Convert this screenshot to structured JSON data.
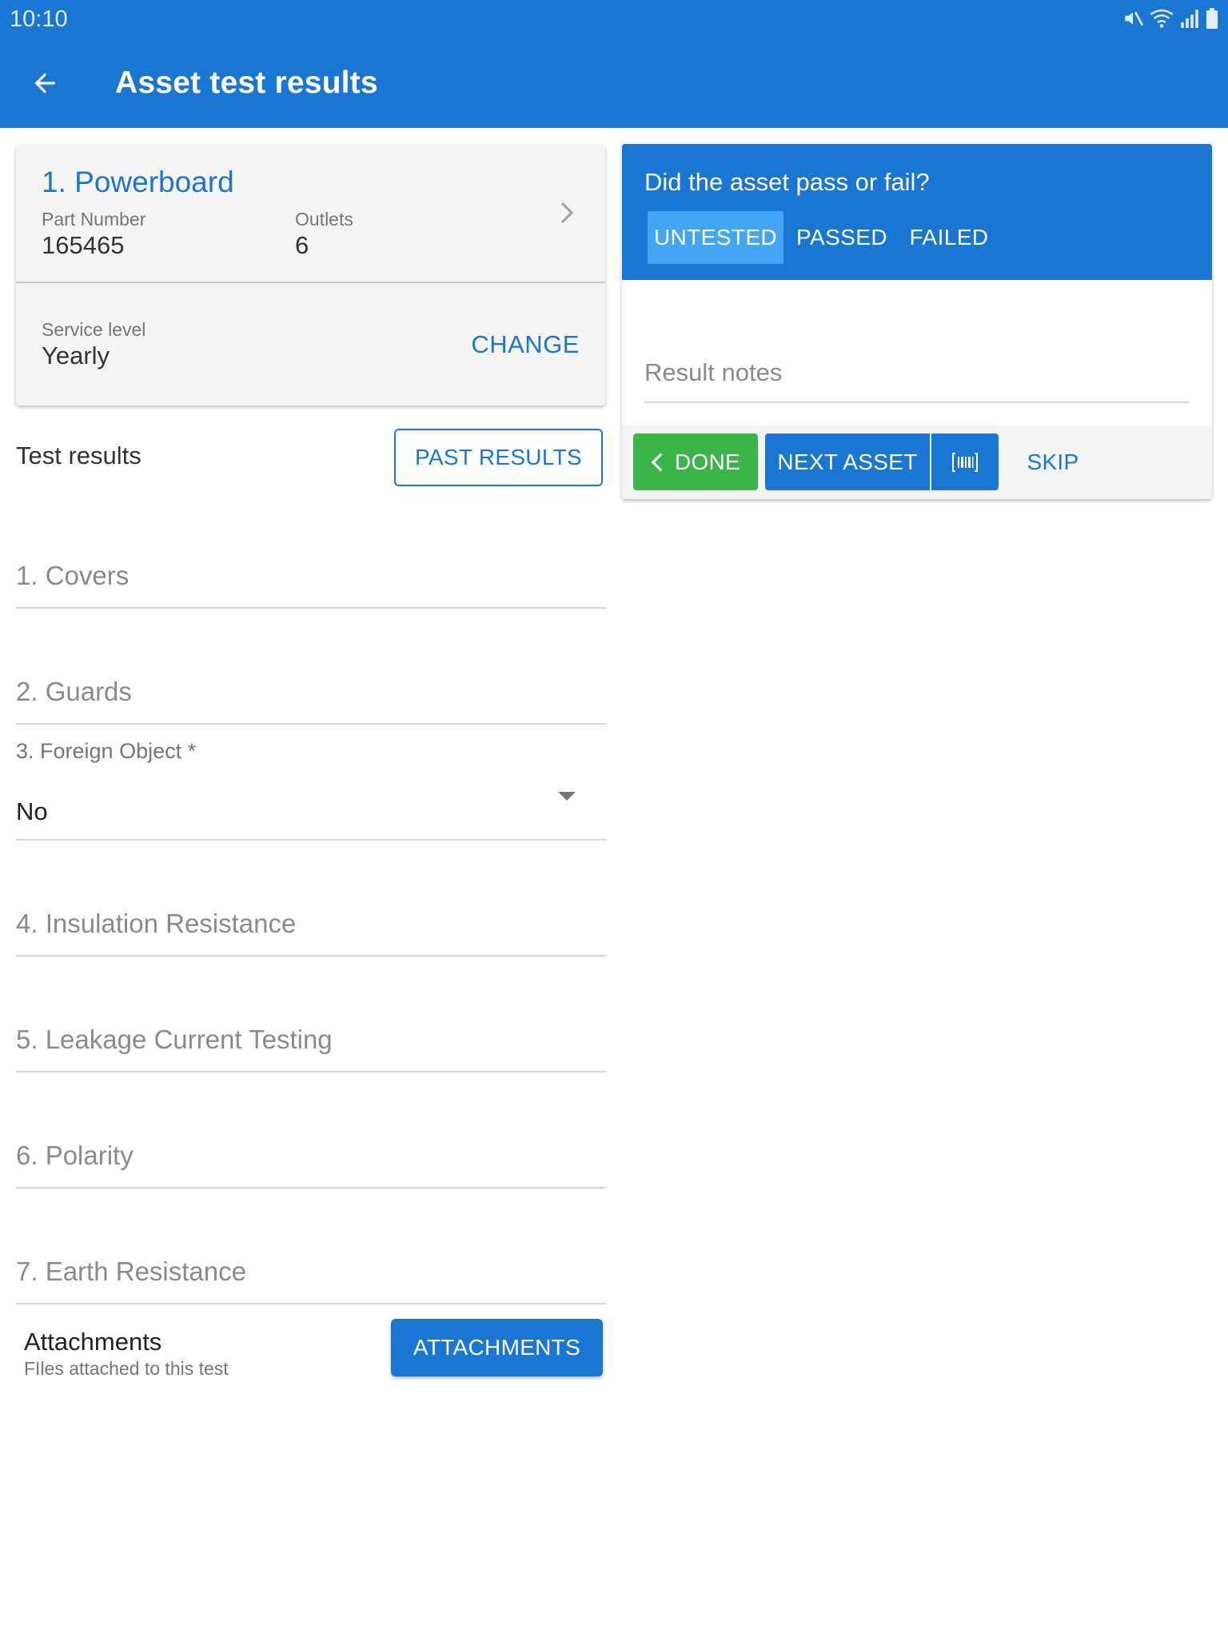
{
  "status_bar": {
    "time": "10:10"
  },
  "app_bar": {
    "title": "Asset test results"
  },
  "asset": {
    "title": "1. Powerboard",
    "part_number_label": "Part Number",
    "part_number": "165465",
    "outlets_label": "Outlets",
    "outlets": "6",
    "service_level_label": "Service level",
    "service_level": "Yearly",
    "change_label": "CHANGE"
  },
  "tests": {
    "section_title": "Test results",
    "past_results_label": "PAST RESULTS",
    "fields": [
      {
        "label": "1. Covers"
      },
      {
        "label": "2. Guards"
      },
      {
        "label": "3. Foreign Object *",
        "value": "No"
      },
      {
        "label": "4. Insulation Resistance"
      },
      {
        "label": "5. Leakage Current Testing"
      },
      {
        "label": "6. Polarity"
      },
      {
        "label": "7. Earth Resistance"
      }
    ]
  },
  "attachments": {
    "title": "Attachments",
    "subtitle": "FIles attached to this test",
    "button_label": "ATTACHMENTS"
  },
  "result": {
    "question": "Did the asset pass or fail?",
    "options": [
      "UNTESTED",
      "PASSED",
      "FAILED"
    ],
    "selected": "UNTESTED",
    "notes_placeholder": "Result notes",
    "done_label": "DONE",
    "next_label": "NEXT ASSET",
    "skip_label": "SKIP"
  },
  "icons": {
    "back": "arrow-left-icon",
    "chevron": "chevron-right-icon",
    "dropdown": "caret-down-icon",
    "done": "chevron-left-icon",
    "scan": "barcode-icon",
    "mute": "mute-icon",
    "wifi": "wifi-icon",
    "signal": "signal-icon",
    "battery": "battery-icon"
  },
  "colors": {
    "primary": "#1976d2",
    "selected_option": "#42a5f5",
    "done_green": "#3bb54a"
  }
}
